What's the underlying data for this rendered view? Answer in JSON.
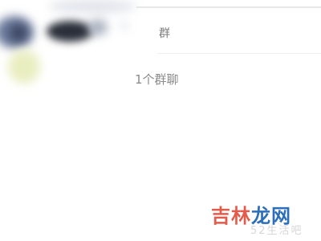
{
  "search": {
    "query": "群"
  },
  "results": {
    "group_count_label": "1个群聊"
  },
  "watermark": {
    "main_part1": "吉林",
    "main_part2": "龙网",
    "sub": "52生活吧"
  },
  "colors": {
    "background": "#ffffff",
    "text_gray": "#8a8a8a",
    "watermark_red": "#e35b4a",
    "watermark_blue": "#2c6fb8"
  }
}
